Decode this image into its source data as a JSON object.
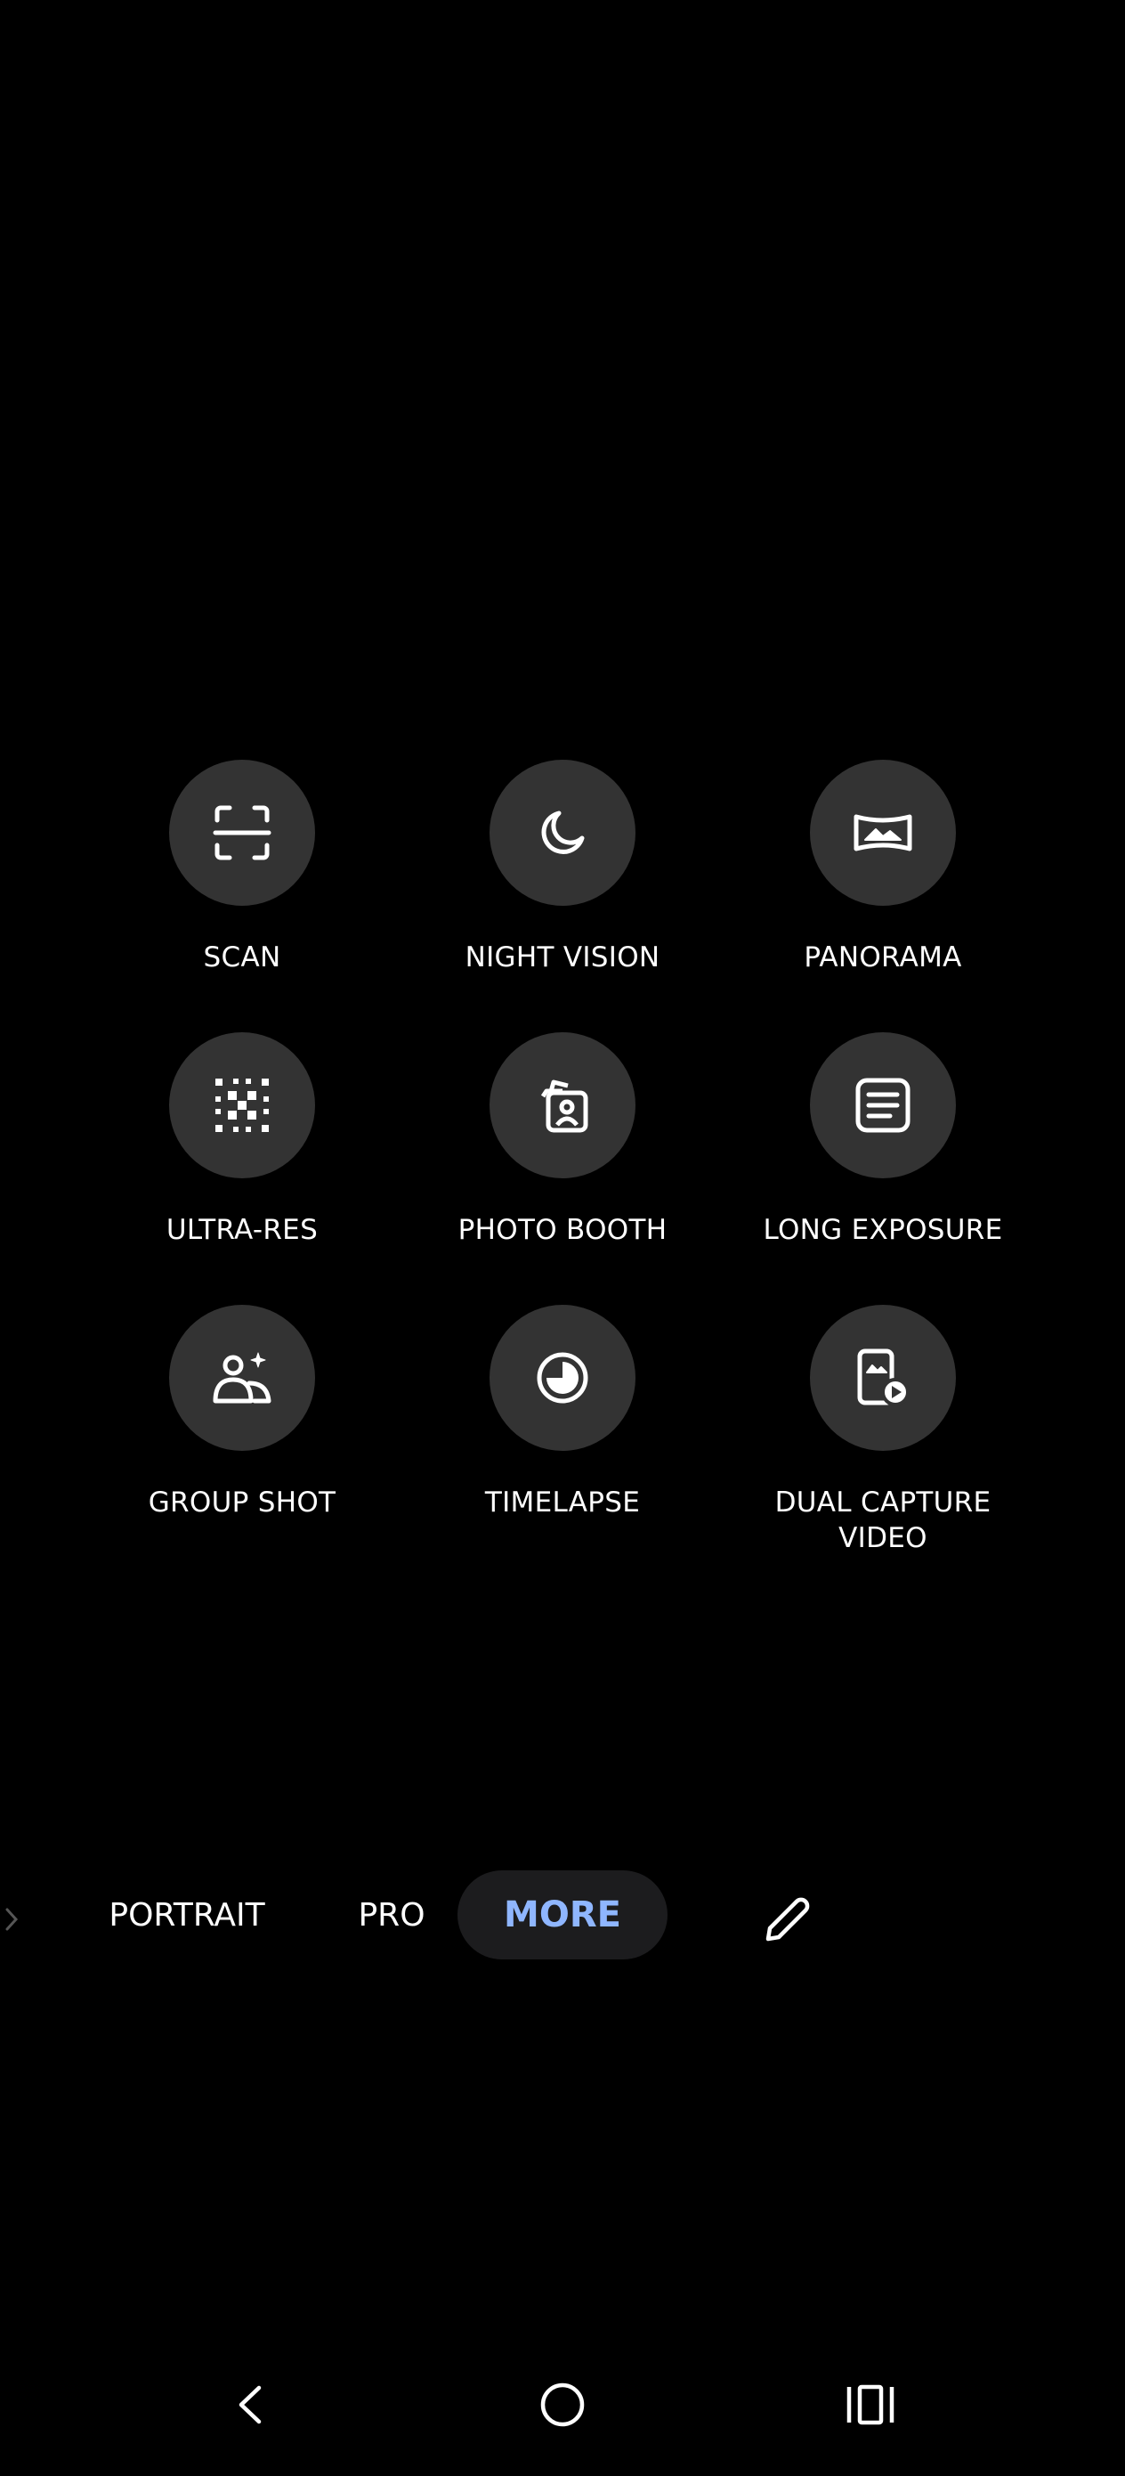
{
  "modes": [
    {
      "id": "scan",
      "label": "SCAN",
      "icon": "scan-icon"
    },
    {
      "id": "night-vision",
      "label": "NIGHT VISION",
      "icon": "moon-icon"
    },
    {
      "id": "panorama",
      "label": "PANORAMA",
      "icon": "panorama-icon"
    },
    {
      "id": "ultra-res",
      "label": "ULTRA-RES",
      "icon": "ultra-res-icon"
    },
    {
      "id": "photo-booth",
      "label": "PHOTO BOOTH",
      "icon": "photo-booth-icon"
    },
    {
      "id": "long-exposure",
      "label": "LONG EXPOSURE",
      "icon": "long-exposure-icon"
    },
    {
      "id": "group-shot",
      "label": "GROUP SHOT",
      "icon": "group-shot-icon"
    },
    {
      "id": "timelapse",
      "label": "TIMELAPSE",
      "icon": "timelapse-icon"
    },
    {
      "id": "dual-capture-video",
      "label": "DUAL CAPTURE\nVIDEO",
      "icon": "dual-capture-video-icon"
    }
  ],
  "mode_bar": {
    "tabs": [
      {
        "label": "PORTRAIT",
        "active": false
      },
      {
        "label": "PRO",
        "active": false
      },
      {
        "label": "MORE",
        "active": true
      }
    ],
    "edit_icon": "pencil-icon",
    "overflow_icon": "chevron-right-icon"
  },
  "nav_bar": {
    "back_icon": "back-icon",
    "home_icon": "home-icon",
    "recents_icon": "recents-icon"
  },
  "colors": {
    "background": "#000000",
    "circle": "#333333",
    "active_tab_text": "#8fb6ff",
    "active_tab_bg": "#1c1c1e"
  }
}
